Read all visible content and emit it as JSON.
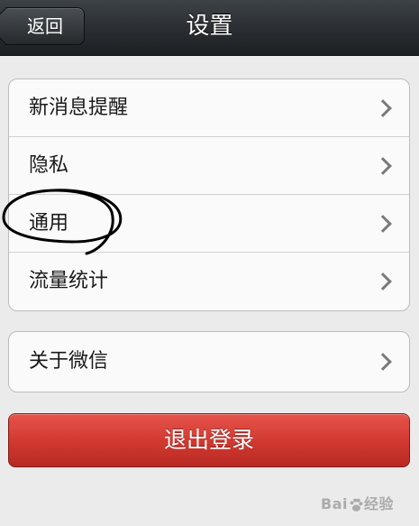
{
  "navbar": {
    "back_label": "返回",
    "title": "设置"
  },
  "group_main": [
    {
      "label": "新消息提醒",
      "icon": "chevron-right-icon"
    },
    {
      "label": "隐私",
      "icon": "chevron-right-icon"
    },
    {
      "label": "通用",
      "icon": "chevron-right-icon"
    },
    {
      "label": "流量统计",
      "icon": "chevron-right-icon"
    }
  ],
  "group_about": [
    {
      "label": "关于微信",
      "icon": "chevron-right-icon"
    }
  ],
  "logout": {
    "label": "退出登录"
  },
  "watermark": {
    "text_a": "Bai",
    "text_b": "经验"
  },
  "colors": {
    "navbar": "#2b2f33",
    "background": "#ebebeb",
    "logout_red": "#d23a31",
    "annotation_ink": "#000000"
  }
}
